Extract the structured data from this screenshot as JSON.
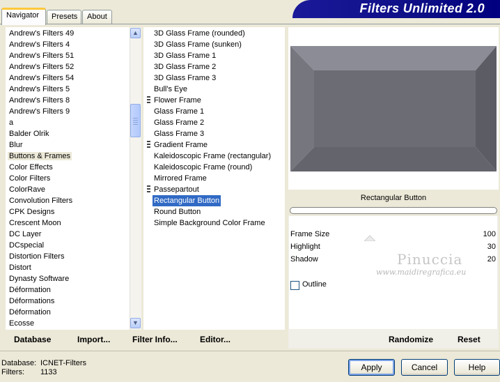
{
  "tabs": [
    "Navigator",
    "Presets",
    "About"
  ],
  "title": "Filters Unlimited 2.0",
  "categories": [
    "Andrew's Filters 49",
    "Andrew's Filters 4",
    "Andrew's Filters 51",
    "Andrew's Filters 52",
    "Andrew's Filters 54",
    "Andrew's Filters 5",
    "Andrew's Filters 8",
    "Andrew's Filters 9",
    "a",
    "Balder Olrik",
    "Blur",
    "Buttons & Frames",
    "Color Effects",
    "Color Filters",
    "ColorRave",
    "Convolution Filters",
    "CPK Designs",
    "Crescent Moon",
    "DC Layer",
    "DCspecial",
    "Distortion Filters",
    "Distort",
    "Dynasty Software",
    "Déformation",
    "Déformations",
    "Déformation",
    "Ecosse"
  ],
  "selected_category": "Buttons & Frames",
  "filters": [
    {
      "label": "3D Glass Frame (rounded)",
      "marker": false
    },
    {
      "label": "3D Glass Frame (sunken)",
      "marker": false
    },
    {
      "label": "3D Glass Frame 1",
      "marker": false
    },
    {
      "label": "3D Glass Frame 2",
      "marker": false
    },
    {
      "label": "3D Glass Frame 3",
      "marker": false
    },
    {
      "label": "Bull's Eye",
      "marker": false
    },
    {
      "label": "Flower Frame",
      "marker": true
    },
    {
      "label": "Glass Frame 1",
      "marker": false
    },
    {
      "label": "Glass Frame 2",
      "marker": false
    },
    {
      "label": "Glass Frame 3",
      "marker": false
    },
    {
      "label": "Gradient Frame",
      "marker": true
    },
    {
      "label": "Kaleidoscopic Frame (rectangular)",
      "marker": false
    },
    {
      "label": "Kaleidoscopic Frame (round)",
      "marker": false
    },
    {
      "label": "Mirrored Frame",
      "marker": false
    },
    {
      "label": "Passepartout",
      "marker": true
    },
    {
      "label": "Rectangular Button",
      "marker": false
    },
    {
      "label": "Round Button",
      "marker": false
    },
    {
      "label": "Simple Background Color Frame",
      "marker": false
    }
  ],
  "selected_filter": "Rectangular Button",
  "preview": {
    "filter_name": "Rectangular Button",
    "colors": {
      "top": "#8c8c96",
      "left": "#76767e",
      "right": "#5c5c64",
      "bottom": "#64646c",
      "center": "#6c6c74"
    }
  },
  "params": [
    {
      "label": "Frame Size",
      "value": "100"
    },
    {
      "label": "Highlight",
      "value": "30"
    },
    {
      "label": "Shadow",
      "value": "20"
    }
  ],
  "outline_label": "Outline",
  "outline_checked": false,
  "watermark": {
    "name": "Pinuccia",
    "site": "www.maidiregrafica.eu"
  },
  "toolbar": {
    "database": "Database",
    "import": "Import...",
    "filter_info": "Filter Info...",
    "editor": "Editor...",
    "randomize": "Randomize",
    "reset": "Reset"
  },
  "status": {
    "database_label": "Database:",
    "database_value": "ICNET-Filters",
    "filters_label": "Filters:",
    "filters_value": "1133"
  },
  "buttons": {
    "apply": "Apply",
    "cancel": "Cancel",
    "help": "Help"
  },
  "accent_color": "#316ac5"
}
